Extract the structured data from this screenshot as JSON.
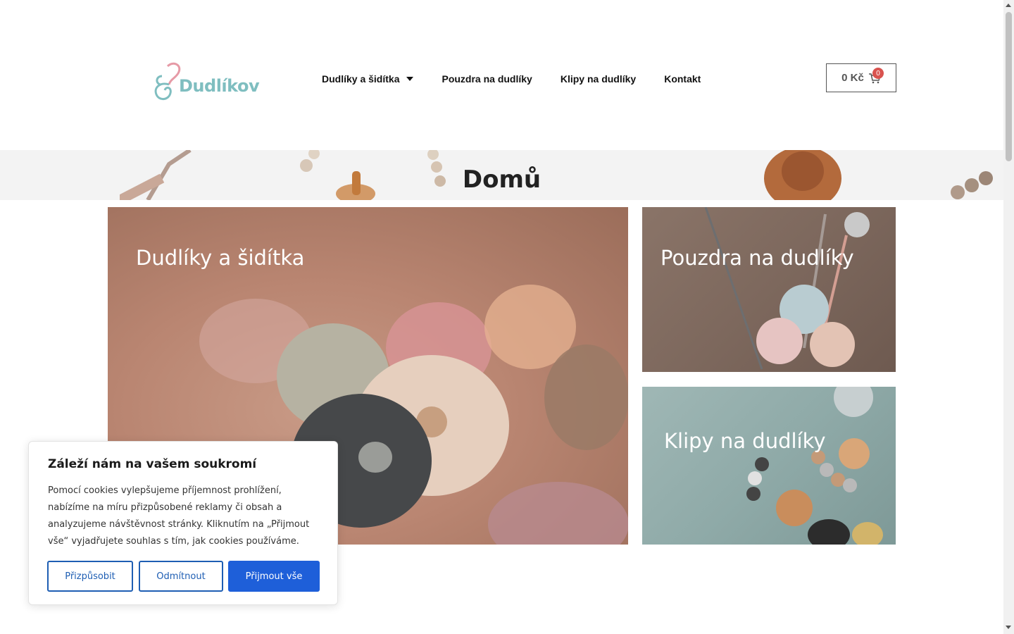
{
  "header": {
    "logo_text": "Dudlíkov",
    "nav": [
      {
        "label": "Dudlíky a šidítka",
        "has_dropdown": true
      },
      {
        "label": "Pouzdra na dudlíky"
      },
      {
        "label": "Klipy na dudlíky"
      },
      {
        "label": "Kontakt"
      }
    ],
    "cart": {
      "price": "0 Kč",
      "count": "0",
      "icon": "cart-icon"
    }
  },
  "banner": {
    "title": "Domů"
  },
  "tiles": [
    {
      "label": "Dudlíky a šidítka"
    },
    {
      "label": "Pouzdra na dudlíky"
    },
    {
      "label": "Klipy na dudlíky"
    }
  ],
  "cookie": {
    "title": "Záleží nám na vašem soukromí",
    "text": "Pomocí cookies vylepšujeme příjemnost prohlížení, nabízíme na míru přizpůsobené reklamy či obsah a analyzujeme návštěvnost stránky. Kliknutím na „Přijmout vše“ vyjadřujete souhlas s tím, jak cookies používáme.",
    "buttons": {
      "customize": "Přizpůsobit",
      "reject": "Odmítnout",
      "accept": "Přijmout vše"
    }
  },
  "colors": {
    "brand": "#7fbec0",
    "brand_accent": "#e69aa6",
    "accept_button": "#1e5fd9",
    "outline_button": "#1e5eb3",
    "cart_badge": "#d9534f"
  }
}
